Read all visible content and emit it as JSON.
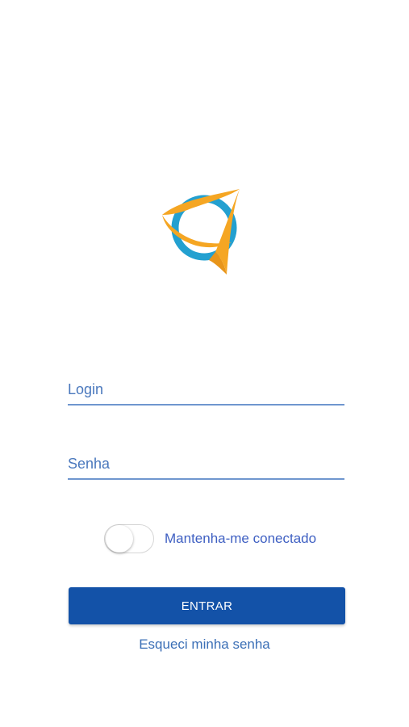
{
  "logo": {
    "icon": "orbit-logo-icon",
    "colors": {
      "ring": "#23a0d0",
      "orbit": "#f5a623"
    }
  },
  "login": {
    "placeholder": "Login",
    "value": ""
  },
  "password": {
    "placeholder": "Senha",
    "value": ""
  },
  "remember": {
    "label": "Mantenha-me conectado",
    "checked": false
  },
  "submit": {
    "label": "ENTRAR",
    "color": "#1352a8"
  },
  "forgot": {
    "label": "Esqueci minha senha"
  }
}
